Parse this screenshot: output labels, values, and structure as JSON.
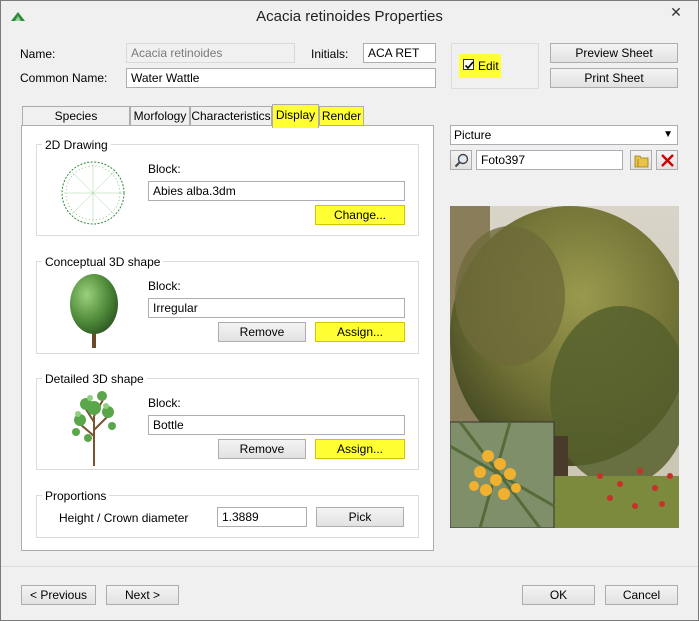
{
  "window": {
    "title": "Acacia retinoides Properties",
    "close_glyph": "✕"
  },
  "header": {
    "name_label": "Name:",
    "name_value": "Acacia retinoides",
    "initials_label": "Initials:",
    "initials_value": "ACA RET",
    "common_name_label": "Common Name:",
    "common_name_value": "Water Wattle",
    "edit_label": "Edit",
    "edit_checked": true,
    "preview_sheet": "Preview Sheet",
    "print_sheet": "Print Sheet"
  },
  "tabs": [
    {
      "label": "Species Information",
      "active": false,
      "highlight": false
    },
    {
      "label": "Morfology",
      "active": false,
      "highlight": false
    },
    {
      "label": "Characteristics",
      "active": false,
      "highlight": false
    },
    {
      "label": "Display",
      "active": true,
      "highlight": true
    },
    {
      "label": "Render",
      "active": false,
      "highlight": true
    }
  ],
  "drawing2d": {
    "title": "2D Drawing",
    "block_label": "Block:",
    "block_value": "Abies alba.3dm",
    "change_button": "Change..."
  },
  "conceptual3d": {
    "title": "Conceptual 3D shape",
    "block_label": "Block:",
    "block_value": "Irregular",
    "remove_button": "Remove",
    "assign_button": "Assign..."
  },
  "detailed3d": {
    "title": "Detailed 3D shape",
    "block_label": "Block:",
    "block_value": "Bottle",
    "remove_button": "Remove",
    "assign_button": "Assign..."
  },
  "proportions": {
    "title": "Proportions",
    "ratio_label": "Height / Crown diameter",
    "ratio_value": "1.3889",
    "pick_button": "Pick"
  },
  "picture": {
    "mode_selected": "Picture",
    "file_value": "Foto397"
  },
  "footer": {
    "previous": "< Previous",
    "next": "Next >",
    "ok": "OK",
    "cancel": "Cancel"
  },
  "icons": {
    "app": "app-logo-icon",
    "search": "magnifier-icon",
    "folder": "folder-icon",
    "delete": "red-x-icon"
  },
  "colors": {
    "highlight": "#ffff33",
    "delete_red": "#d00000"
  }
}
